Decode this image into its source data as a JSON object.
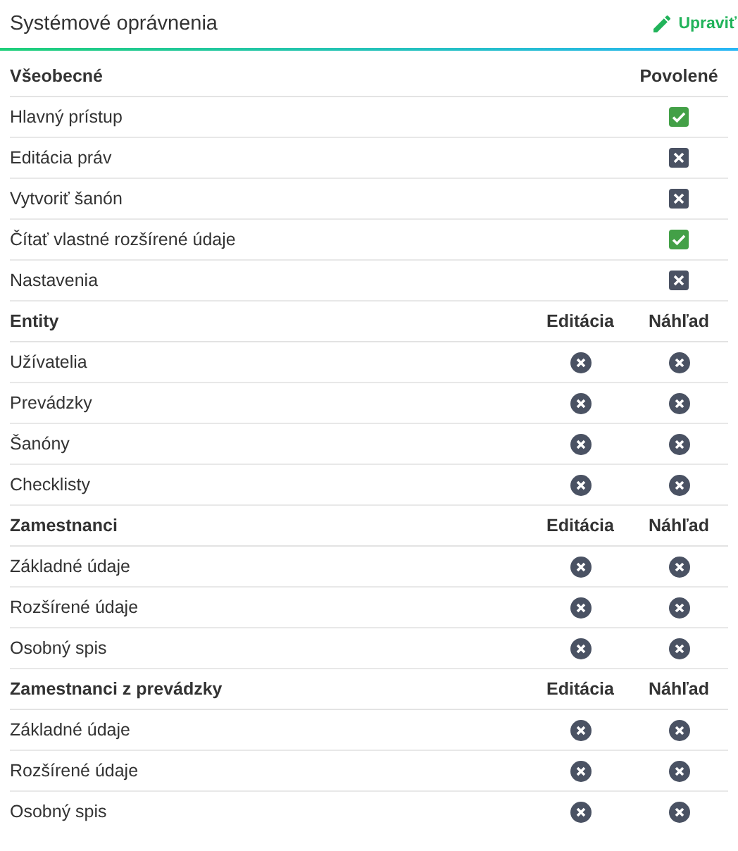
{
  "panel": {
    "title": "Systémové oprávnenia",
    "edit_link": "Upraviť"
  },
  "sections": [
    {
      "title": "Všeobecné",
      "kind": "square",
      "columns": [
        "Povolené"
      ],
      "rows": [
        {
          "label": "Hlavný prístup",
          "values": [
            true
          ]
        },
        {
          "label": "Editácia práv",
          "values": [
            false
          ]
        },
        {
          "label": "Vytvoriť šanón",
          "values": [
            false
          ]
        },
        {
          "label": "Čítať vlastné rozšírené údaje",
          "values": [
            true
          ]
        },
        {
          "label": "Nastavenia",
          "values": [
            false
          ]
        }
      ]
    },
    {
      "title": "Entity",
      "kind": "round",
      "columns": [
        "Editácia",
        "Náhľad"
      ],
      "rows": [
        {
          "label": "Užívatelia",
          "values": [
            false,
            false
          ]
        },
        {
          "label": "Prevádzky",
          "values": [
            false,
            false
          ]
        },
        {
          "label": "Šanóny",
          "values": [
            false,
            false
          ]
        },
        {
          "label": "Checklisty",
          "values": [
            false,
            false
          ]
        }
      ]
    },
    {
      "title": "Zamestnanci",
      "kind": "round",
      "columns": [
        "Editácia",
        "Náhľad"
      ],
      "rows": [
        {
          "label": "Základné údaje",
          "values": [
            false,
            false
          ]
        },
        {
          "label": "Rozšírené údaje",
          "values": [
            false,
            false
          ]
        },
        {
          "label": "Osobný spis",
          "values": [
            false,
            false
          ]
        }
      ]
    },
    {
      "title": "Zamestnanci z prevádzky",
      "kind": "round",
      "columns": [
        "Editácia",
        "Náhľad"
      ],
      "rows": [
        {
          "label": "Základné údaje",
          "values": [
            false,
            false
          ]
        },
        {
          "label": "Rozšírené údaje",
          "values": [
            false,
            false
          ]
        },
        {
          "label": "Osobný spis",
          "values": [
            false,
            false
          ]
        }
      ]
    }
  ]
}
